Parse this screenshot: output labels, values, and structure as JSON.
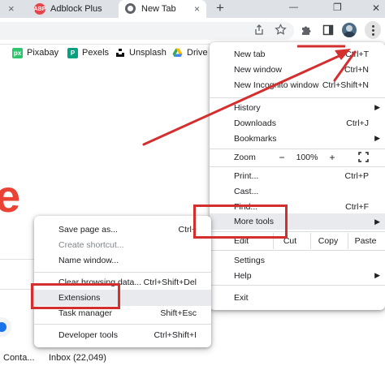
{
  "tabs": [
    {
      "label": "Adblock Plus",
      "favicon": "ABP",
      "close": "×"
    },
    {
      "label": "New Tab",
      "close": "×"
    }
  ],
  "new_tab_button": "+",
  "window_controls": {
    "minimize": "—",
    "restore": "❐",
    "close": "✕"
  },
  "bookmarks": [
    {
      "label": "Pixabay",
      "icon_text": "px"
    },
    {
      "label": "Pexels",
      "icon_text": "P"
    },
    {
      "label": "Unsplash"
    },
    {
      "label": "Drive"
    }
  ],
  "page": {
    "big_letter": "e",
    "tiles": [
      {
        "label": "Conta..."
      },
      {
        "label": "Inbox (22,049)"
      }
    ]
  },
  "chrome_menu": {
    "groups": [
      [
        {
          "label": "New tab",
          "shortcut": "Ctrl+T"
        },
        {
          "label": "New window",
          "shortcut": "Ctrl+N"
        },
        {
          "label": "New Incognito window",
          "shortcut": "Ctrl+Shift+N"
        }
      ],
      [
        {
          "label": "History"
        },
        {
          "label": "Downloads",
          "shortcut": "Ctrl+J"
        },
        {
          "label": "Bookmarks"
        }
      ]
    ],
    "zoom": {
      "label": "Zoom",
      "minus": "−",
      "value": "100%",
      "plus": "+"
    },
    "print": {
      "label": "Print...",
      "shortcut": "Ctrl+P"
    },
    "cast": {
      "label": "Cast..."
    },
    "find": {
      "label": "Find...",
      "shortcut": "Ctrl+F"
    },
    "more_tools": {
      "label": "More tools"
    },
    "edit": {
      "label": "Edit",
      "cut": "Cut",
      "copy": "Copy",
      "paste": "Paste"
    },
    "settings": {
      "label": "Settings"
    },
    "help": {
      "label": "Help"
    },
    "exit": {
      "label": "Exit"
    }
  },
  "more_tools_menu": {
    "items": [
      {
        "label": "Save page as...",
        "shortcut": "Ctrl+"
      },
      {
        "label": "Create shortcut...",
        "disabled": true
      },
      {
        "label": "Name window..."
      },
      {
        "label": "Clear browsing data...",
        "shortcut": "Ctrl+Shift+Del"
      },
      {
        "label": "Extensions"
      },
      {
        "label": "Task manager",
        "shortcut": "Shift+Esc"
      },
      {
        "label": "Developer tools",
        "shortcut": "Ctrl+Shift+I"
      }
    ]
  },
  "colors": {
    "annotation_red": "#d32f2f",
    "google_red": "#ea4335",
    "chrome_blue": "#1a73e8"
  }
}
